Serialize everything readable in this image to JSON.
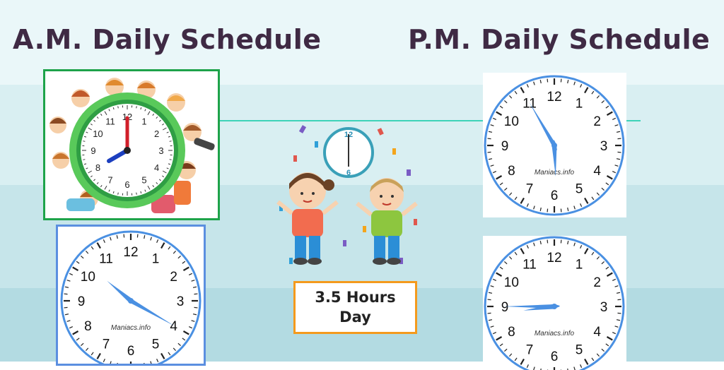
{
  "header": {
    "am_title": "A.M. Daily Schedule",
    "pm_title": "P.M. Daily Schedule"
  },
  "center": {
    "hours_line1": "3.5 Hours",
    "hours_line2": "Day"
  },
  "clock_numerals": [
    "12",
    "1",
    "2",
    "3",
    "4",
    "5",
    "6",
    "7",
    "8",
    "9",
    "10",
    "11"
  ],
  "watermark": "Maniacs.info",
  "clocks": {
    "am_kids_clock": {
      "hour": 8,
      "minute": 0
    },
    "am_clock_2": {
      "hour": 10,
      "minute": 20
    },
    "pm_clock_1": {
      "hour": 5,
      "minute": 55
    },
    "pm_clock_2": {
      "hour": 8,
      "minute": 45
    },
    "celebration_clock": {
      "hour": 6,
      "minute": 0
    }
  },
  "colors": {
    "title": "#3f2a44",
    "band_1": "#eaf7f9",
    "band_2": "#d9eff2",
    "band_3": "#c6e5ea",
    "band_4": "#b3dbe2",
    "green_frame": "#1ea34a",
    "blue_frame": "#5b8fe0",
    "clock_ring": "#4a90e2",
    "hours_border": "#f49a1d"
  }
}
